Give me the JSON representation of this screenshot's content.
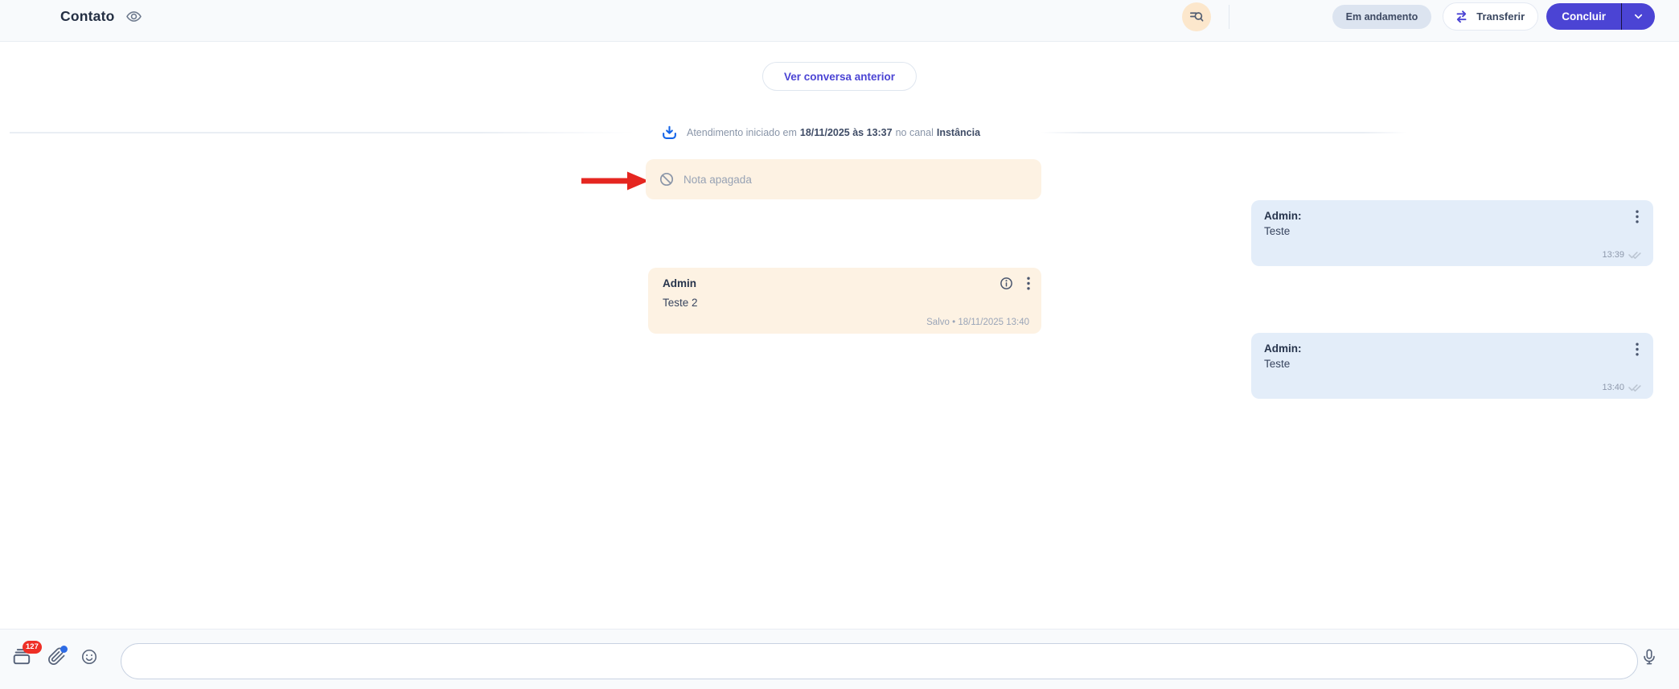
{
  "colors": {
    "accent": "#4b44d4",
    "bar_bg": "#f8fafc",
    "bar_border": "#e8edf3",
    "status_badge_bg": "#dce4f0",
    "status_badge_text": "#3e4a63",
    "search_button_bg": "#fce7cc",
    "note_bg": "#fdf2e3",
    "message_bg": "#e3edf9",
    "badge_red": "#ee2f26",
    "arrow_red": "#e52620",
    "system_blue": "#1565e8",
    "input_border": "#c8d2e2"
  },
  "header": {
    "title": "Contato",
    "status_badge": "Em andamento",
    "transfer_button": "Transferir",
    "conclude_button": "Concluir"
  },
  "chat": {
    "previous_conversation_button": "Ver conversa anterior",
    "system_event": {
      "prefix": "Atendimento iniciado em",
      "datetime": "18/11/2025 às 13:37",
      "connector": "no canal",
      "channel": "Instância"
    },
    "deleted_note": "Nota apagada",
    "note": {
      "author": "Admin",
      "text": "Teste 2",
      "meta": "Salvo • 18/11/2025 13:40"
    },
    "messages": [
      {
        "author": "Admin:",
        "text": "Teste",
        "time": "13:39"
      },
      {
        "author": "Admin:",
        "text": "Teste",
        "time": "13:40"
      }
    ]
  },
  "composer": {
    "quick_replies_badge": "127",
    "message_input_value": ""
  }
}
